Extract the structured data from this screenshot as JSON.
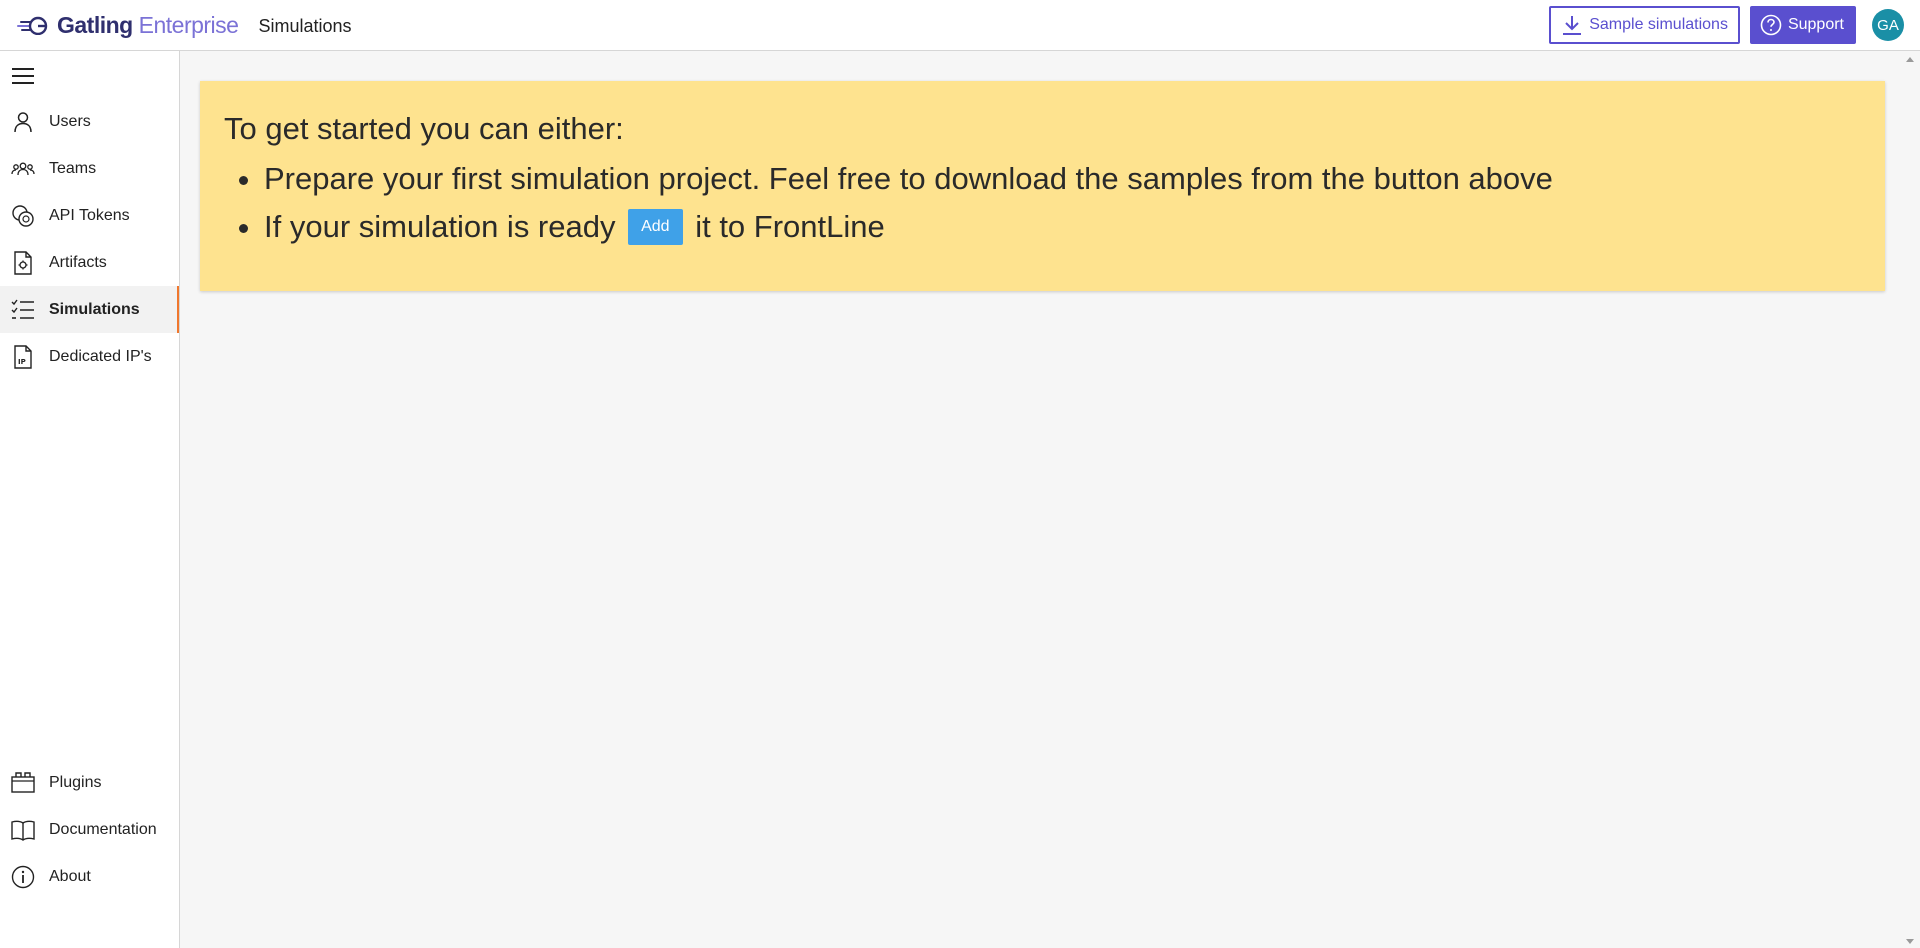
{
  "header": {
    "logo": {
      "part1": "Gatling",
      "part2": "Enterprise"
    },
    "title": "Simulations",
    "sample_button": "Sample simulations",
    "support_button": "Support",
    "avatar_initials": "GA"
  },
  "sidebar": {
    "items": [
      {
        "label": "Users",
        "icon": "user-icon"
      },
      {
        "label": "Teams",
        "icon": "team-icon"
      },
      {
        "label": "API Tokens",
        "icon": "token-icon"
      },
      {
        "label": "Artifacts",
        "icon": "artifact-icon"
      },
      {
        "label": "Simulations",
        "icon": "list-check-icon",
        "active": true
      },
      {
        "label": "Dedicated IP's",
        "icon": "ip-document-icon"
      }
    ],
    "bottom_items": [
      {
        "label": "Plugins",
        "icon": "plugin-icon"
      },
      {
        "label": "Documentation",
        "icon": "book-icon"
      },
      {
        "label": "About",
        "icon": "info-icon"
      }
    ]
  },
  "banner": {
    "heading": "To get started you can either:",
    "item1": "Prepare your first simulation project. Feel free to download the samples from the button above",
    "item2_before": "If your simulation is ready",
    "item2_button": "Add",
    "item2_after": "it to FrontLine"
  },
  "colors": {
    "accent": "#5a4fcf",
    "banner_bg": "#fee38f",
    "add_button": "#3fa1e8",
    "active_marker": "#f0772d",
    "avatar_bg": "#1a8fa6"
  }
}
